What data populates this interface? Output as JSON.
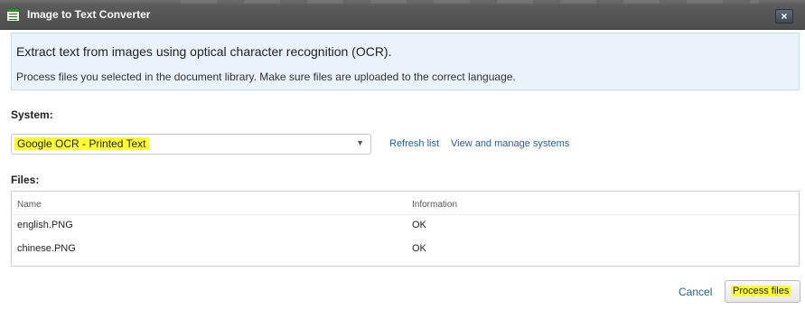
{
  "window": {
    "title": "Image to Text Converter",
    "close_label": "×"
  },
  "info": {
    "heading": "Extract text from images using optical character recognition (OCR).",
    "description": "Process files you selected in the document library. Make sure files are uploaded to the correct language."
  },
  "system": {
    "label": "System:",
    "selected": "Google OCR - Printed Text",
    "refresh_link": "Refresh list",
    "manage_link": "View and manage systems"
  },
  "files": {
    "label": "Files:",
    "columns": [
      "Name",
      "Information"
    ],
    "rows": [
      {
        "name": "english.PNG",
        "information": "OK"
      },
      {
        "name": "chinese.PNG",
        "information": "OK"
      }
    ]
  },
  "actions": {
    "cancel": "Cancel",
    "process": "Process files"
  },
  "colors": {
    "titlebar": "#555555",
    "info_bg": "#eaf3fb",
    "link": "#1f5f9e",
    "highlight": "#ffff33"
  }
}
